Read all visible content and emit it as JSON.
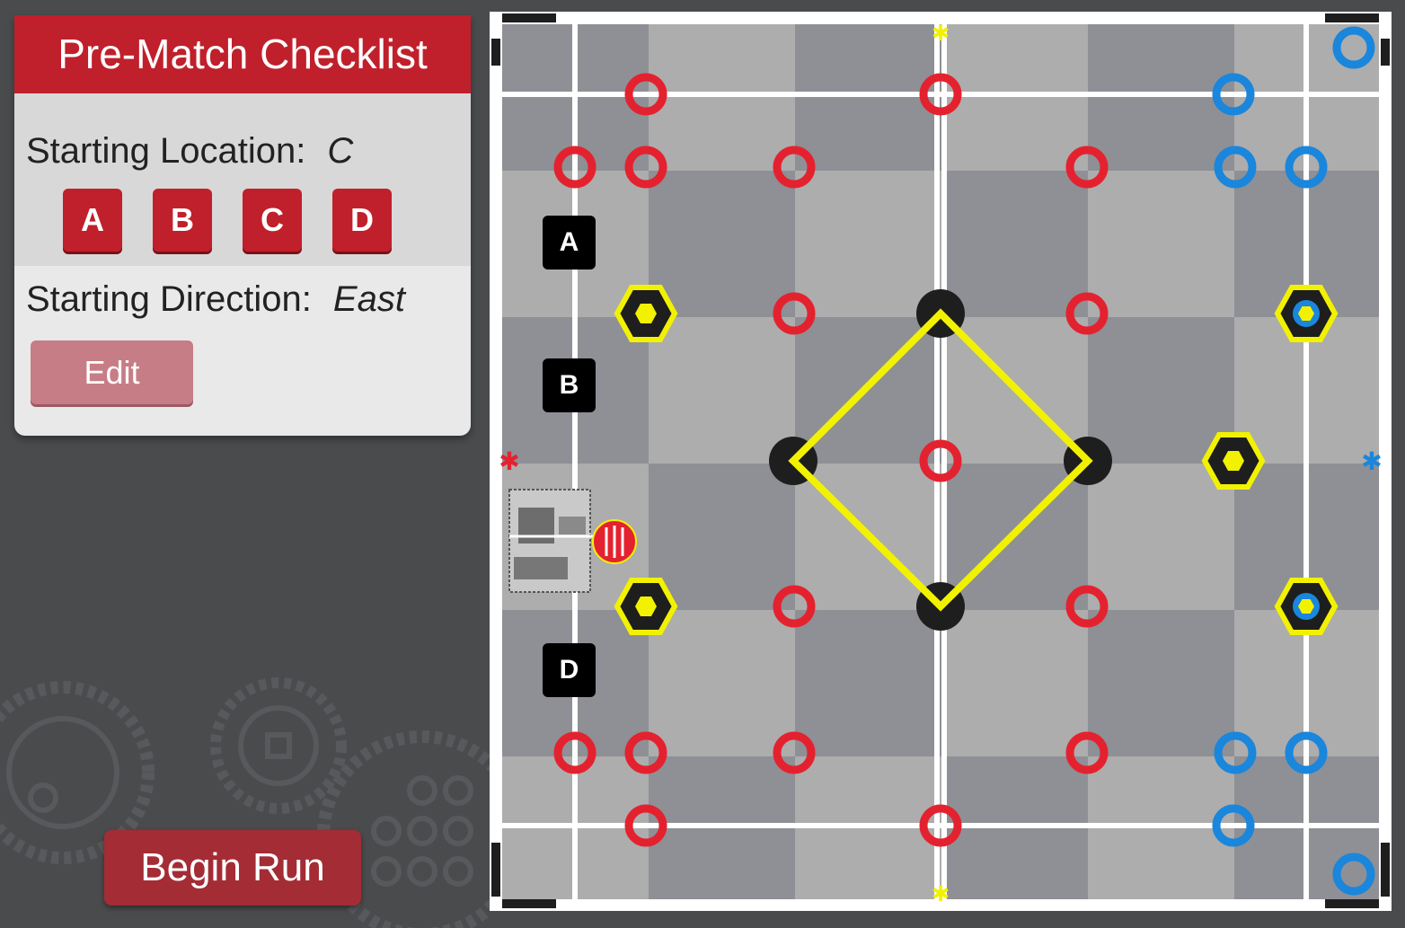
{
  "checklist": {
    "title": "Pre-Match Checklist",
    "starting_location_label": "Starting Location:",
    "starting_location_value": "C",
    "location_buttons": [
      "A",
      "B",
      "C",
      "D"
    ],
    "starting_direction_label": "Starting Direction:",
    "starting_direction_value": "East",
    "edit_label": "Edit"
  },
  "begin_run_label": "Begin Run",
  "field": {
    "start_markers": [
      "A",
      "B",
      "D"
    ],
    "colors": {
      "red": "#e4222f",
      "blue": "#1a86dc",
      "goal_yellow": "#f2f200",
      "goal_dark": "#1e1e1e",
      "tile_light": "#adadad",
      "tile_dark": "#8e9095"
    }
  },
  "colors": {
    "accent": "#c0202b",
    "panel_bg": "#e9e9e9",
    "page_bg": "#4a4b4d"
  }
}
